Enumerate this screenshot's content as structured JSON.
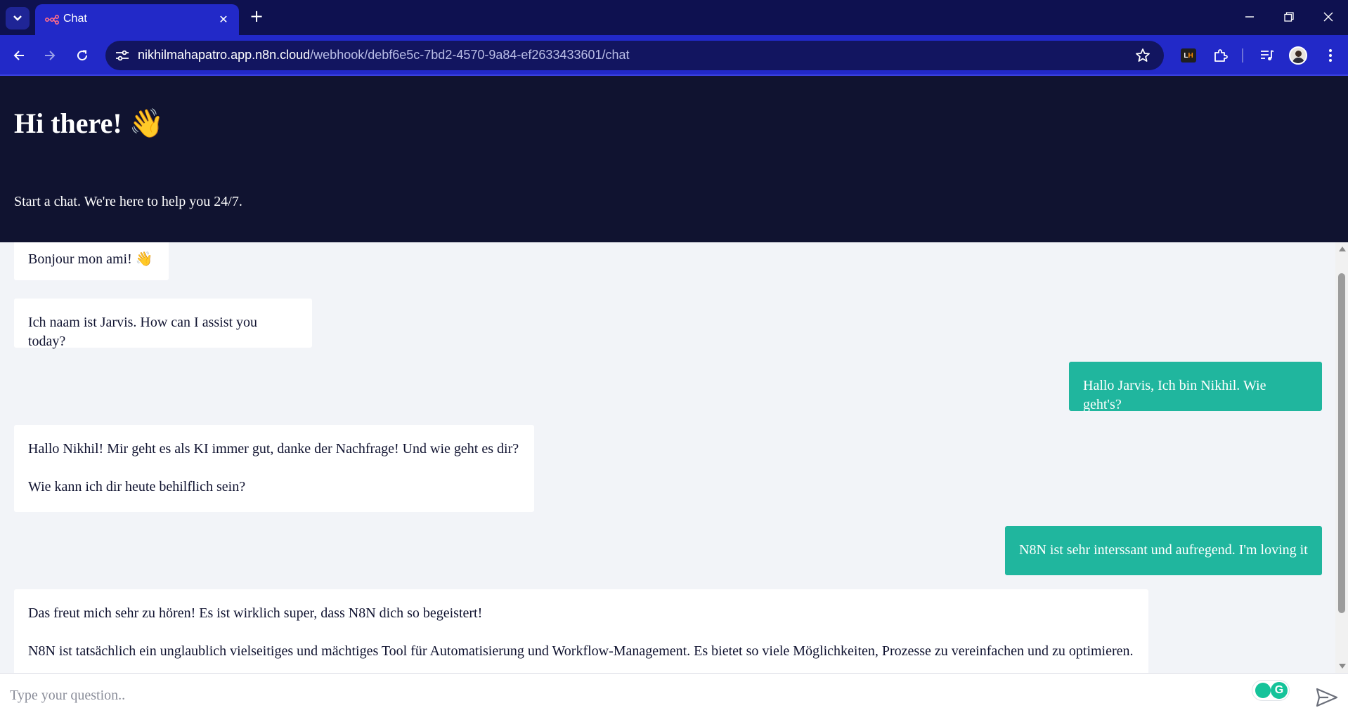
{
  "browser": {
    "tab_title": "Chat",
    "url_domain": "nikhilmahapatro.app.n8n.cloud",
    "url_path": "/webhook/debf6e5c-7bd2-4570-9a84-ef2633433601/chat",
    "close_tab_glyph": "✕",
    "new_tab_glyph": "+",
    "extension_label_l": "L",
    "extension_label_h": "H",
    "accent_color": "#2229c8",
    "tabbar_color": "#0e1150"
  },
  "header": {
    "title": "Hi there! 👋",
    "subtitle": "Start a chat. We're here to help you 24/7.",
    "background_color": "#101330"
  },
  "messages": [
    {
      "sender": "bot",
      "lines": [
        "Bonjour mon ami! 👋"
      ]
    },
    {
      "sender": "bot",
      "lines": [
        "Ich naam ist Jarvis. How can I assist you today?"
      ]
    },
    {
      "sender": "user",
      "lines": [
        "Hallo Jarvis, Ich bin Nikhil. Wie geht's?"
      ]
    },
    {
      "sender": "bot",
      "lines": [
        "Hallo Nikhil! Mir geht es als KI immer gut, danke der Nachfrage! Und wie geht es dir?",
        "Wie kann ich dir heute behilflich sein?"
      ]
    },
    {
      "sender": "user",
      "lines": [
        "N8N ist sehr interssant und aufregend. I'm loving it"
      ]
    },
    {
      "sender": "bot",
      "lines": [
        "Das freut mich sehr zu hören! Es ist wirklich super, dass N8N dich so begeistert!",
        "N8N ist tatsächlich ein unglaublich vielseitiges und mächtiges Tool für Automatisierung und Workflow-Management. Es bietet so viele Möglichkeiten, Prozesse zu vereinfachen und zu optimieren."
      ]
    }
  ],
  "colors": {
    "user_bubble": "#20b69e",
    "bot_bubble": "#ffffff",
    "page_background": "#f2f4f8"
  },
  "input": {
    "placeholder": "Type your question..",
    "value": "",
    "grammarly_letter": "G"
  },
  "icons": {
    "tab_search": "chevron-down-icon",
    "favicon": "n8n-logo-icon",
    "back": "arrow-left-icon",
    "forward": "arrow-right-icon",
    "reload": "reload-icon",
    "site_info": "tune-icon",
    "bookmark": "star-icon",
    "extensions": "puzzle-icon",
    "media": "media-controls-icon",
    "profile": "avatar",
    "menu": "more-vertical-icon",
    "send": "send-icon"
  }
}
